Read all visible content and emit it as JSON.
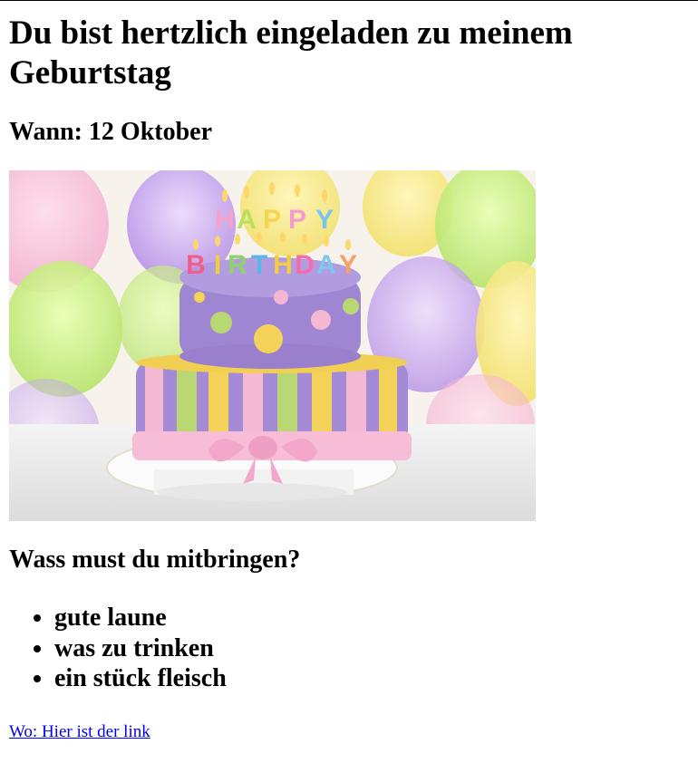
{
  "header": {
    "title": "Du bist hertzlich eingeladen zu meinem Geburtstag",
    "when": "Wann: 12 Oktober"
  },
  "image": {
    "cake_top_letters": [
      "H",
      "A",
      "P",
      "P",
      "Y"
    ],
    "cake_bottom_letters": [
      "B",
      "I",
      "R",
      "T",
      "H",
      "D",
      "A",
      "Y"
    ]
  },
  "bring": {
    "heading": "Wass must du mitbringen?",
    "items": [
      "gute laune",
      "was zu trinken",
      "ein stück fleisch"
    ]
  },
  "footer": {
    "link_text": "Wo: Hier ist der link"
  },
  "colors": {
    "link": "#0000ee",
    "cake_purple": "#a58bd6",
    "cake_pink": "#f5b8d2",
    "cake_yellow": "#f4d25a",
    "cake_green": "#b9d873"
  }
}
